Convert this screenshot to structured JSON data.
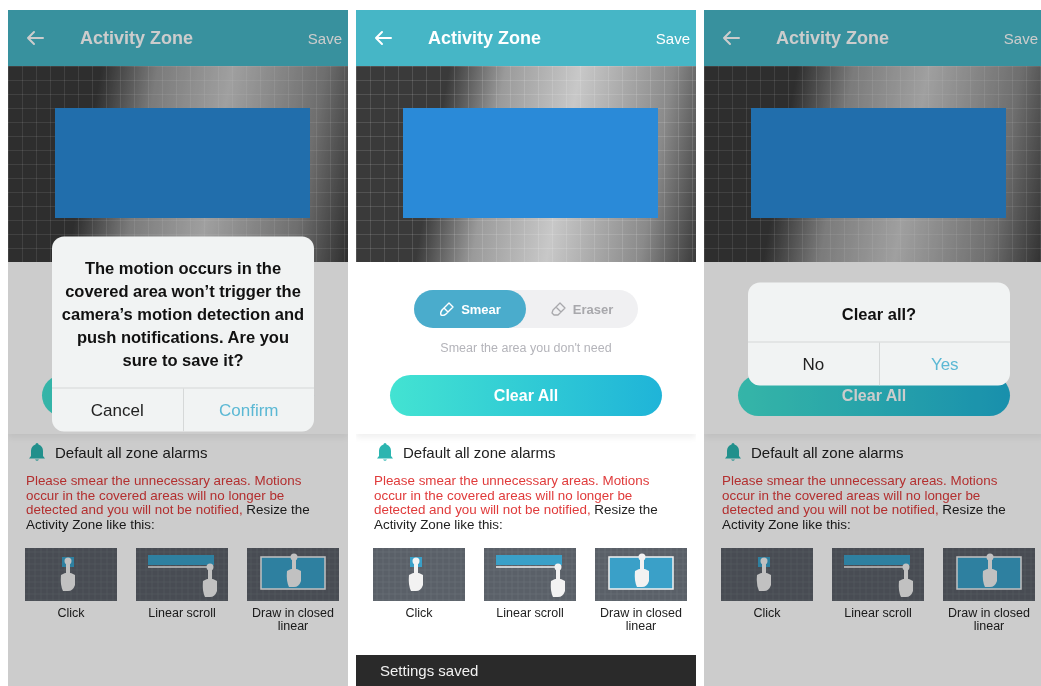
{
  "screens": [
    {
      "header": {
        "title": "Activity Zone",
        "action": "Save"
      },
      "clear_button": {
        "covered": true
      },
      "alarm": {
        "label": "Default all zone alarms"
      },
      "notice": {
        "warning": "Please smear the unnecessary areas. Motions occur in the covered areas will no longer be detected and you will not be notified,",
        "text": " Resize the Activity Zone like this:"
      },
      "tutorials": [
        {
          "kind": "click",
          "caption": "Click"
        },
        {
          "kind": "scroll",
          "caption": "Linear scroll"
        },
        {
          "kind": "closed",
          "caption": "Draw in closed linear"
        }
      ],
      "dialog": {
        "message": "The motion occurs in the covered area won’t trigger the camera’s motion detection and push notifications. Are you sure to save it?",
        "buttons": [
          {
            "label": "Cancel",
            "primary": false
          },
          {
            "label": "Confirm",
            "primary": true
          }
        ]
      }
    },
    {
      "header": {
        "title": "Activity Zone",
        "action": "Save"
      },
      "mode_toggle": {
        "options": [
          {
            "kind": "brush",
            "label": "Smear",
            "selected": true
          },
          {
            "kind": "eraser",
            "label": "Eraser",
            "selected": false
          }
        ],
        "hint": "Smear the area you don't need"
      },
      "clear_button": {
        "label": "Clear All"
      },
      "alarm": {
        "label": "Default all zone alarms"
      },
      "notice": {
        "warning": "Please smear the unnecessary areas. Motions occur in the covered areas will no longer be detected and you will not be notified,",
        "text": " Resize the Activity Zone like this:"
      },
      "tutorials": [
        {
          "kind": "click",
          "caption": "Click"
        },
        {
          "kind": "scroll",
          "caption": "Linear scroll"
        },
        {
          "kind": "closed",
          "caption": "Draw in closed linear"
        }
      ],
      "toast": "Settings saved"
    },
    {
      "header": {
        "title": "Activity Zone",
        "action": "Save"
      },
      "clear_button": {
        "label": "Clear All"
      },
      "alarm": {
        "label": "Default all zone alarms"
      },
      "notice": {
        "warning": "Please smear the unnecessary areas. Motions occur in the covered areas will no longer be detected and you will not be notified,",
        "text": " Resize the Activity Zone like this:"
      },
      "tutorials": [
        {
          "kind": "click",
          "caption": "Click"
        },
        {
          "kind": "scroll",
          "caption": "Linear scroll"
        },
        {
          "kind": "closed",
          "caption": "Draw in closed linear"
        }
      ],
      "dialog": {
        "message": "Clear all?",
        "buttons": [
          {
            "label": "No",
            "primary": false
          },
          {
            "label": "Yes",
            "primary": true
          }
        ]
      }
    }
  ]
}
